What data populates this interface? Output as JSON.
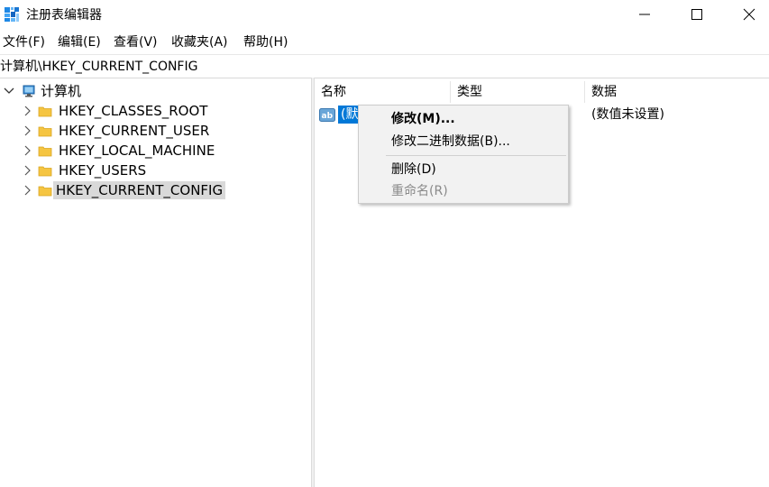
{
  "window": {
    "title": "注册表编辑器",
    "icon": "registry-editor-icon",
    "controls": {
      "minimize": "minimize-icon",
      "maximize": "maximize-icon",
      "close": "close-icon"
    }
  },
  "menubar": {
    "items": [
      "文件(F)",
      "编辑(E)",
      "查看(V)",
      "收藏夹(A)",
      "帮助(H)"
    ]
  },
  "address": {
    "path": "计算机\\HKEY_CURRENT_CONFIG"
  },
  "tree": {
    "root": {
      "label": "计算机",
      "expanded": true,
      "icon": "computer-icon"
    },
    "keys": [
      {
        "label": "HKEY_CLASSES_ROOT",
        "selected": false
      },
      {
        "label": "HKEY_CURRENT_USER",
        "selected": false
      },
      {
        "label": "HKEY_LOCAL_MACHINE",
        "selected": false
      },
      {
        "label": "HKEY_USERS",
        "selected": false
      },
      {
        "label": "HKEY_CURRENT_CONFIG",
        "selected": true
      }
    ]
  },
  "values": {
    "columns": [
      "名称",
      "类型",
      "数据"
    ],
    "rows": [
      {
        "name": "(默",
        "type": "",
        "data": "(数值未设置)",
        "icon": "string-value-icon"
      }
    ]
  },
  "context_menu": {
    "items": [
      {
        "label": "修改(M)...",
        "bold": true,
        "enabled": true
      },
      {
        "label": "修改二进制数据(B)...",
        "bold": false,
        "enabled": true
      },
      {
        "label": "删除(D)",
        "bold": false,
        "enabled": true
      },
      {
        "label": "重命名(R)",
        "bold": false,
        "enabled": false
      }
    ]
  },
  "colors": {
    "selection_blue": "#0078d7",
    "tree_selected_bg": "#d9d9d9",
    "folder_yellow": "#f5c542",
    "disabled_text": "#8a8a8a"
  }
}
